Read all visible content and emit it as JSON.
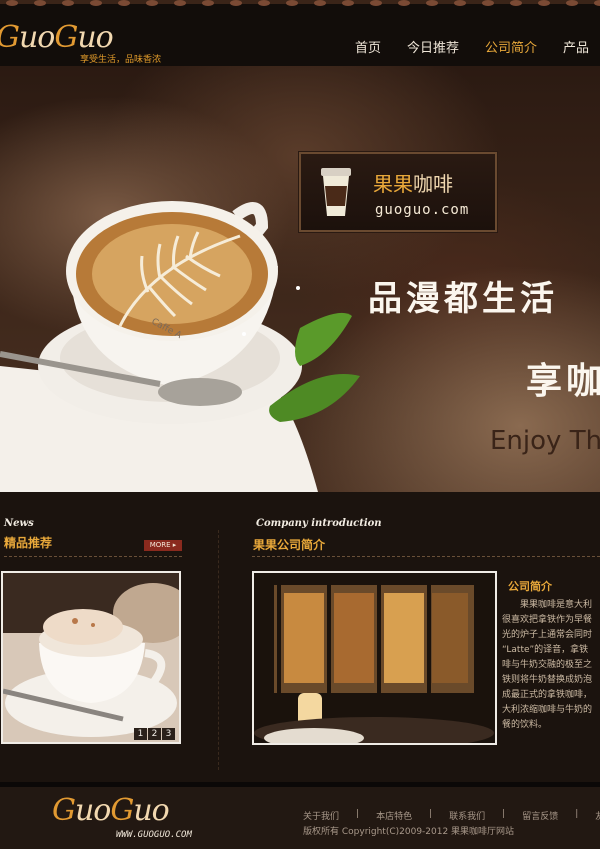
{
  "header": {
    "logo_part1": "G",
    "logo_part2": "uo",
    "logo_part3": "G",
    "logo_part4": "uo",
    "tagline": "享受生活，品味香浓",
    "nav": [
      {
        "label": "首页"
      },
      {
        "label": "今日推荐"
      },
      {
        "label": "公司简介"
      },
      {
        "label": "产品"
      }
    ],
    "active_index": 2
  },
  "banner": {
    "brand_highlight": "果果",
    "brand_rest": "咖啡",
    "url": "guoguo.com",
    "slogan_line1": "品漫都生活",
    "slogan_line2": "享咖",
    "enjoy_text": "Enjoy Th",
    "cup_label": "Caffe A"
  },
  "news": {
    "label_en": "News",
    "title": "精品推荐",
    "more_label": "MORE ▸",
    "pager": [
      "1",
      "2",
      "3"
    ]
  },
  "company": {
    "label_en": "Company introduction",
    "title": "果果公司简介",
    "about_title": "公司简介",
    "about_lines": [
      "　　果果咖啡是意大利",
      "很喜欢把拿铁作为早餐",
      "光的炉子上通常会同时",
      "“Latte”的译音，拿铁",
      "啡与牛奶交融的极至之",
      "铁则将牛奶替换成奶泡",
      "成最正式的拿铁咖啡，",
      "大利浓缩咖啡与牛奶的",
      "餐的饮料。"
    ]
  },
  "footer": {
    "logo_part1": "G",
    "logo_part2": "uo",
    "logo_part3": "G",
    "logo_part4": "uo",
    "url": "WWW.GUOGUO.COM",
    "links": [
      "关于我们",
      "本店特色",
      "联系我们",
      "留言反馈",
      "友"
    ],
    "copyright": "版权所有 Copyright(C)2009-2012 果果咖啡厅网站"
  },
  "colors": {
    "accent": "#e8a83a",
    "background": "#17110d",
    "more_button": "#8a2a1e"
  }
}
